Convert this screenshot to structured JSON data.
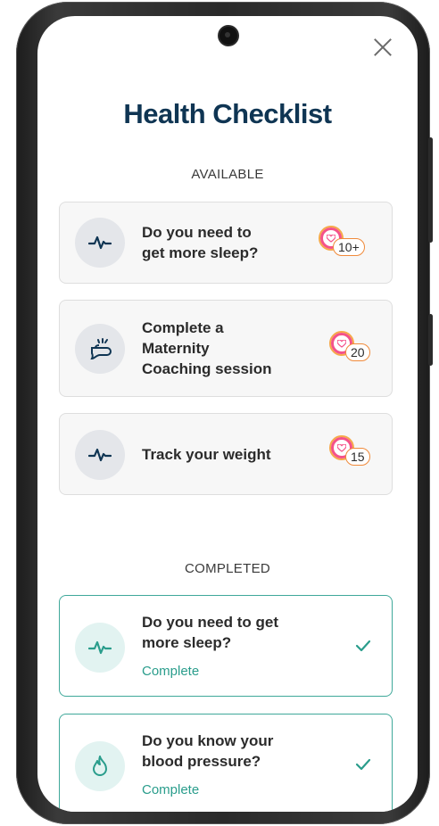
{
  "header": {
    "title": "Health Checklist"
  },
  "sections": {
    "available_label": "AVAILABLE",
    "completed_label": "COMPLETED"
  },
  "available": [
    {
      "label_line1": "Do you need to",
      "label_line2": "get more sleep?",
      "points": "10+",
      "icon": "heartbeat-icon"
    },
    {
      "label_line1": "Complete a",
      "label_line2": "Maternity",
      "label_line3": "Coaching session",
      "points": "20",
      "icon": "coaching-icon"
    },
    {
      "label_line1": "Track your weight",
      "points": "15",
      "icon": "heartbeat-icon"
    }
  ],
  "completed": [
    {
      "label_line1": "Do you need to get",
      "label_line2": "more sleep?",
      "status": "Complete",
      "icon": "heartbeat-icon"
    },
    {
      "label_line1": "Do you know your",
      "label_line2": "blood pressure?",
      "status": "Complete",
      "icon": "flame-icon"
    }
  ],
  "colors": {
    "title": "#0f3553",
    "accent_teal": "#2a9d8c",
    "badge_pink": "#f4528a",
    "badge_orange": "#f08a3a"
  }
}
